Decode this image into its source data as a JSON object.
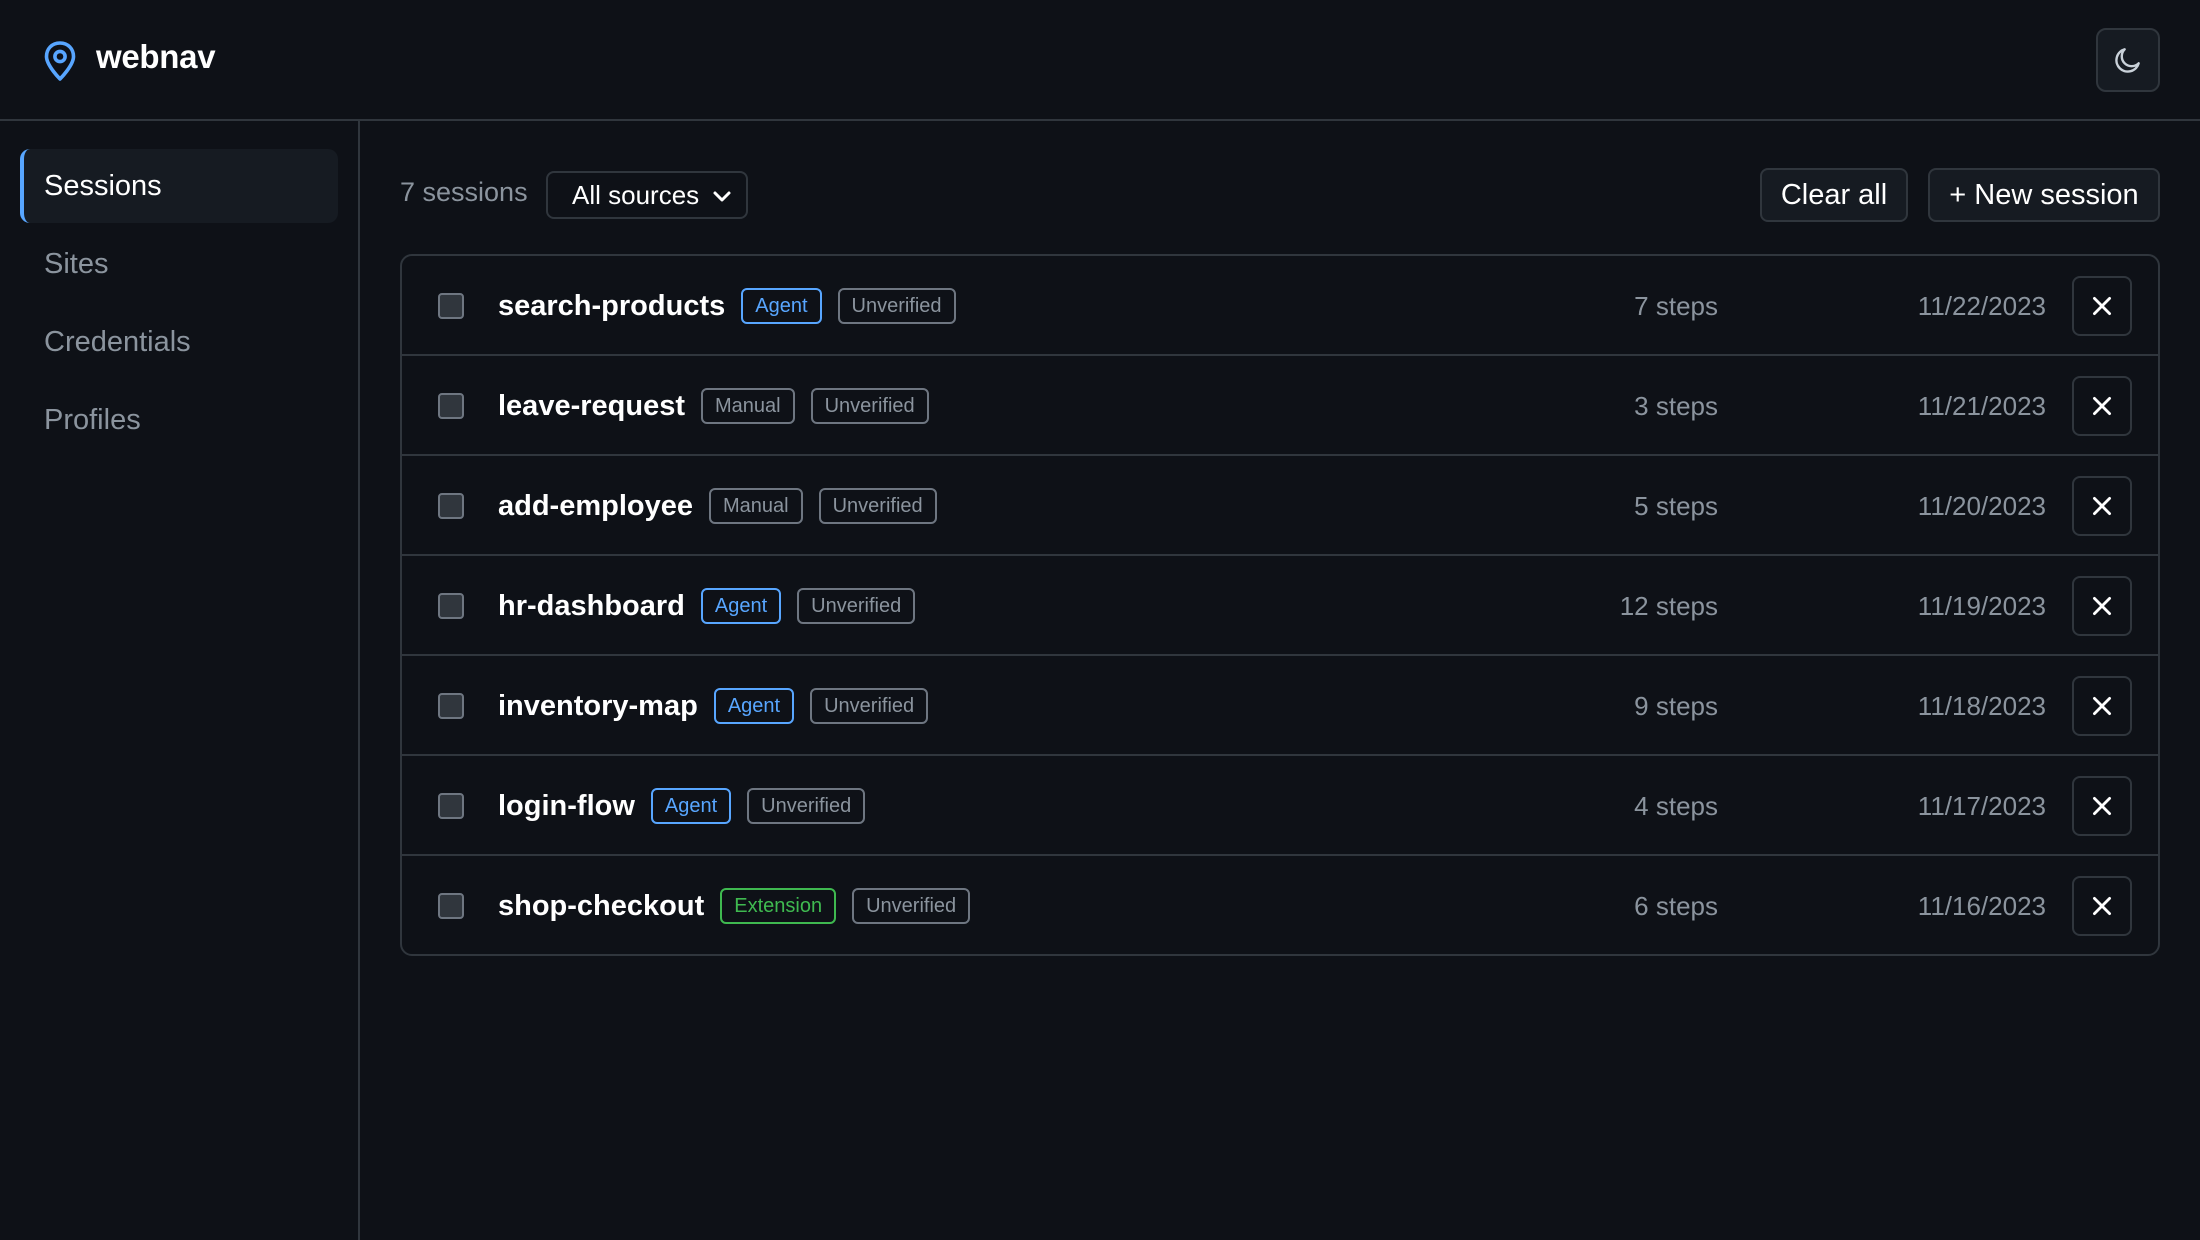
{
  "app": {
    "brand": "webnav",
    "logo_icon": "map-pin-icon",
    "theme_icon": "moon-icon",
    "accent": "#58a6ff"
  },
  "sidebar": {
    "items": [
      {
        "label": "Sessions",
        "active": true
      },
      {
        "label": "Sites",
        "active": false
      },
      {
        "label": "Credentials",
        "active": false
      },
      {
        "label": "Profiles",
        "active": false
      }
    ]
  },
  "toolbar": {
    "session_count": "7 sessions",
    "source_filter": "All sources",
    "clear_label": "Clear all",
    "new_label": "+ New session"
  },
  "sessions": [
    {
      "name": "search-products",
      "source": "Agent",
      "status": "Unverified",
      "steps": "7 steps",
      "date": "11/22/2023"
    },
    {
      "name": "leave-request",
      "source": "Manual",
      "status": "Unverified",
      "steps": "3 steps",
      "date": "11/21/2023"
    },
    {
      "name": "add-employee",
      "source": "Manual",
      "status": "Unverified",
      "steps": "5 steps",
      "date": "11/20/2023"
    },
    {
      "name": "hr-dashboard",
      "source": "Agent",
      "status": "Unverified",
      "steps": "12 steps",
      "date": "11/19/2023"
    },
    {
      "name": "inventory-map",
      "source": "Agent",
      "status": "Unverified",
      "steps": "9 steps",
      "date": "11/18/2023"
    },
    {
      "name": "login-flow",
      "source": "Agent",
      "status": "Unverified",
      "steps": "4 steps",
      "date": "11/17/2023"
    },
    {
      "name": "shop-checkout",
      "source": "Extension",
      "status": "Unverified",
      "steps": "6 steps",
      "date": "11/16/2023"
    }
  ]
}
